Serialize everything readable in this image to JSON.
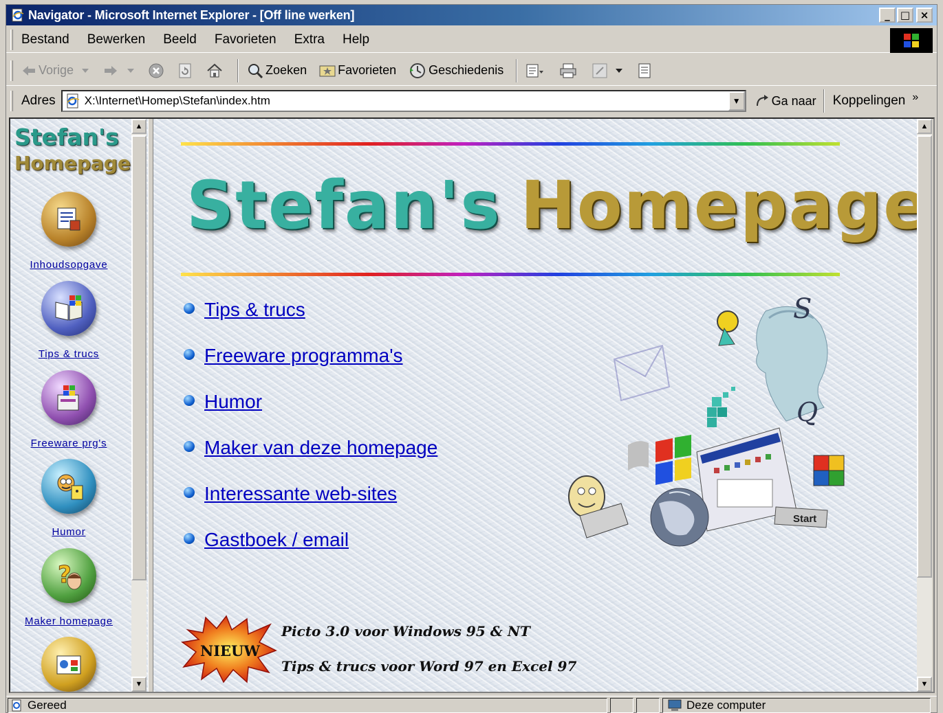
{
  "window": {
    "title": "Navigator - Microsoft Internet Explorer - [Off line werken]",
    "controls": {
      "minimize": "_",
      "maximize": "□",
      "close": "×"
    }
  },
  "menu": [
    "Bestand",
    "Bewerken",
    "Beeld",
    "Favorieten",
    "Extra",
    "Help"
  ],
  "toolbar": {
    "back": "Vorige",
    "search": "Zoeken",
    "favorites": "Favorieten",
    "history": "Geschiedenis"
  },
  "address": {
    "label": "Adres",
    "url": "X:\\Internet\\Homep\\Stefan\\index.htm",
    "go": "Ga naar",
    "links": "Koppelingen"
  },
  "sidebar": {
    "logo_line1": "Stefan's",
    "logo_line2": "Homepage",
    "items": [
      {
        "label": "Inhoudsopgave",
        "icon": "contents-icon"
      },
      {
        "label": "Tips & trucs",
        "icon": "book-icon"
      },
      {
        "label": "Freeware prg's",
        "icon": "software-icon"
      },
      {
        "label": "Humor",
        "icon": "cartoon-icon"
      },
      {
        "label": "Maker homepage",
        "icon": "question-icon"
      },
      {
        "label": "",
        "icon": "web-icon"
      }
    ]
  },
  "main": {
    "logo_part1": "Stefan's",
    "logo_part2": "Homepage",
    "links": [
      "Tips & trucs",
      "Freeware programma's",
      "Humor",
      "Maker van deze homepage",
      "Interessante web-sites",
      "Gastboek / email"
    ],
    "badge": "NIEUW",
    "news": [
      "Picto 3.0 voor Windows 95 & NT",
      "Tips & trucs voor Word 97 en Excel 97"
    ],
    "clipart_start_label": "Start"
  },
  "status": {
    "text": "Gereed",
    "zone": "Deze computer"
  },
  "colors": {
    "titlebar_start": "#0a246a",
    "titlebar_end": "#a6caf0",
    "link": "#0000c0",
    "chrome": "#d4d0c8"
  }
}
